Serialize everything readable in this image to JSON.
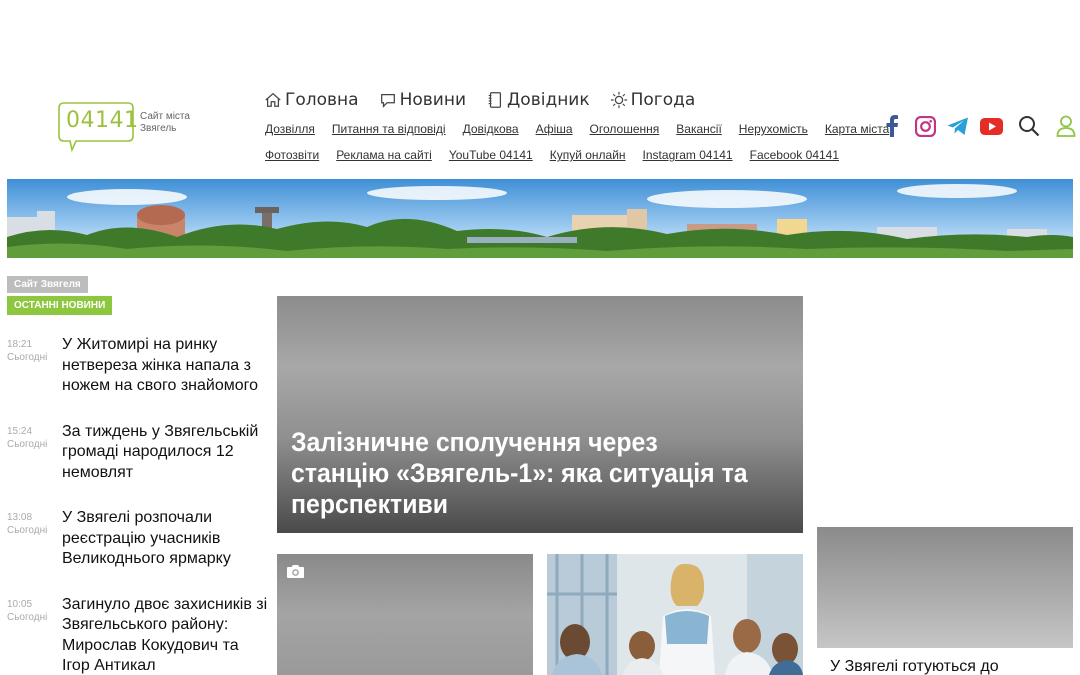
{
  "logo": {
    "number": "04141",
    "caption_line1": "Сайт міста",
    "caption_line2": "Звягель"
  },
  "main_nav": [
    {
      "label": "Головна",
      "icon": "home-icon"
    },
    {
      "label": "Новини",
      "icon": "chat-icon"
    },
    {
      "label": "Довідник",
      "icon": "notebook-icon"
    },
    {
      "label": "Погода",
      "icon": "sun-icon"
    }
  ],
  "sub_nav_row1": [
    "Дозвілля",
    "Питання та відповіді",
    "Довідкова",
    "Афіша",
    "Оголошення",
    "Вакансії",
    "Нерухомість",
    "Карта міста"
  ],
  "sub_nav_row2": [
    "Фотозвіти",
    "Реклама на сайті",
    "YouTube 04141",
    "Купуй онлайн",
    "Instagram 04141",
    "Facebook 04141"
  ],
  "social_icons": [
    "facebook-icon",
    "instagram-icon",
    "telegram-icon",
    "youtube-icon",
    "search-icon",
    "user-icon"
  ],
  "colors": {
    "accent": "#8dc63f",
    "facebook": "#3b5998",
    "instagram": "#c13584",
    "telegram": "#2a9fd8",
    "youtube": "#e52d27"
  },
  "tags": {
    "site": "Сайт Звягеля",
    "latest": "ОСТАННІ НОВИНИ"
  },
  "news": [
    {
      "time": "18:21",
      "day": "Сьогодні",
      "title": "У Житомирі на ринку нетвереза жінка напала з ножем на свого знайомого"
    },
    {
      "time": "15:24",
      "day": "Сьогодні",
      "title": "За тиждень у Звягельській громаді народилося 12 немовлят"
    },
    {
      "time": "13:08",
      "day": "Сьогодні",
      "title": "У Звягелі розпочали реєстрацію учасників Великоднього ярмарку"
    },
    {
      "time": "10:05",
      "day": "Сьогодні",
      "title": "Загинуло двоє захисників зі Звягельського району: Мирослав Кокудович та Ігор Антикал"
    }
  ],
  "featured": {
    "title": "Залізничне сполучення через станцію «Звягель-1»: яка ситуація та перспективи"
  },
  "side_card": {
    "title": "У Звягелі готуються до"
  }
}
